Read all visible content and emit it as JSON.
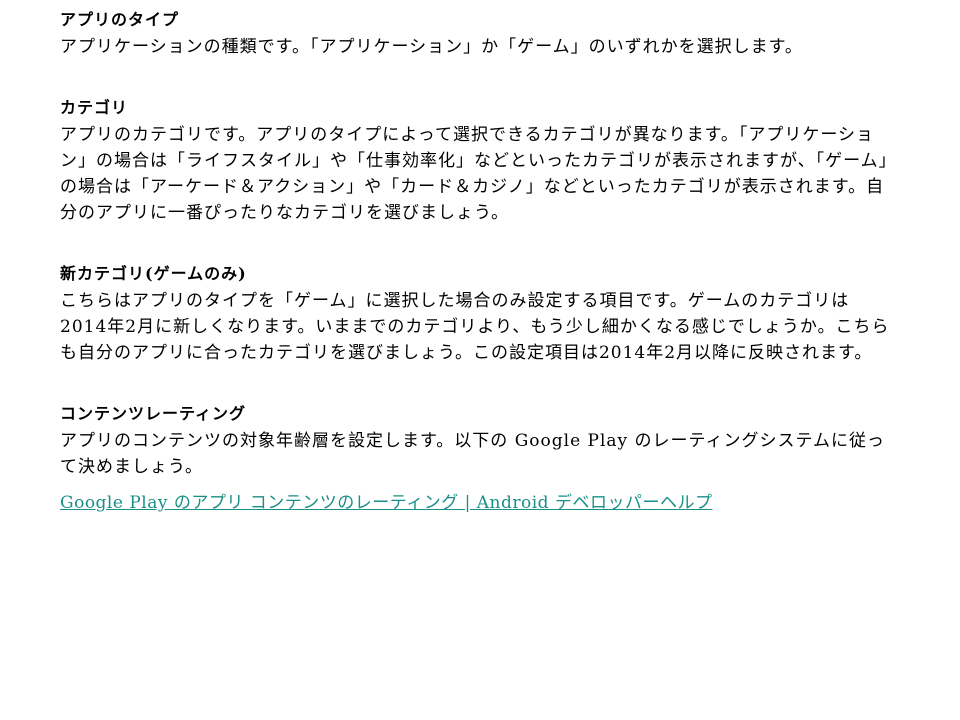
{
  "sections": [
    {
      "title": "アプリのタイプ",
      "body": "アプリケーションの種類です。「アプリケーション」か「ゲーム」のいずれかを選択します。"
    },
    {
      "title": "カテゴリ",
      "body": "アプリのカテゴリです。アプリのタイプによって選択できるカテゴリが異なります。「アプリケーション」の場合は「ライフスタイル」や「仕事効率化」などといったカテゴリが表示されますが、「ゲーム」の場合は「アーケード＆アクション」や「カード＆カジノ」などといったカテゴリが表示されます。自分のアプリに一番ぴったりなカテゴリを選びましょう。"
    },
    {
      "title": "新カテゴリ(ゲームのみ)",
      "body": "こちらはアプリのタイプを「ゲーム」に選択した場合のみ設定する項目です。ゲームのカテゴリは2014年2月に新しくなります。いままでのカテゴリより、もう少し細かくなる感じでしょうか。こちらも自分のアプリに合ったカテゴリを選びましょう。この設定項目は2014年2月以降に反映されます。"
    },
    {
      "title": "コンテンツレーティング",
      "body": "アプリのコンテンツの対象年齢層を設定します。以下の Google Play のレーティングシステムに従って決めましょう。"
    }
  ],
  "link": {
    "text": "Google Play のアプリ コンテンツのレーティング | Android デベロッパーヘルプ"
  }
}
